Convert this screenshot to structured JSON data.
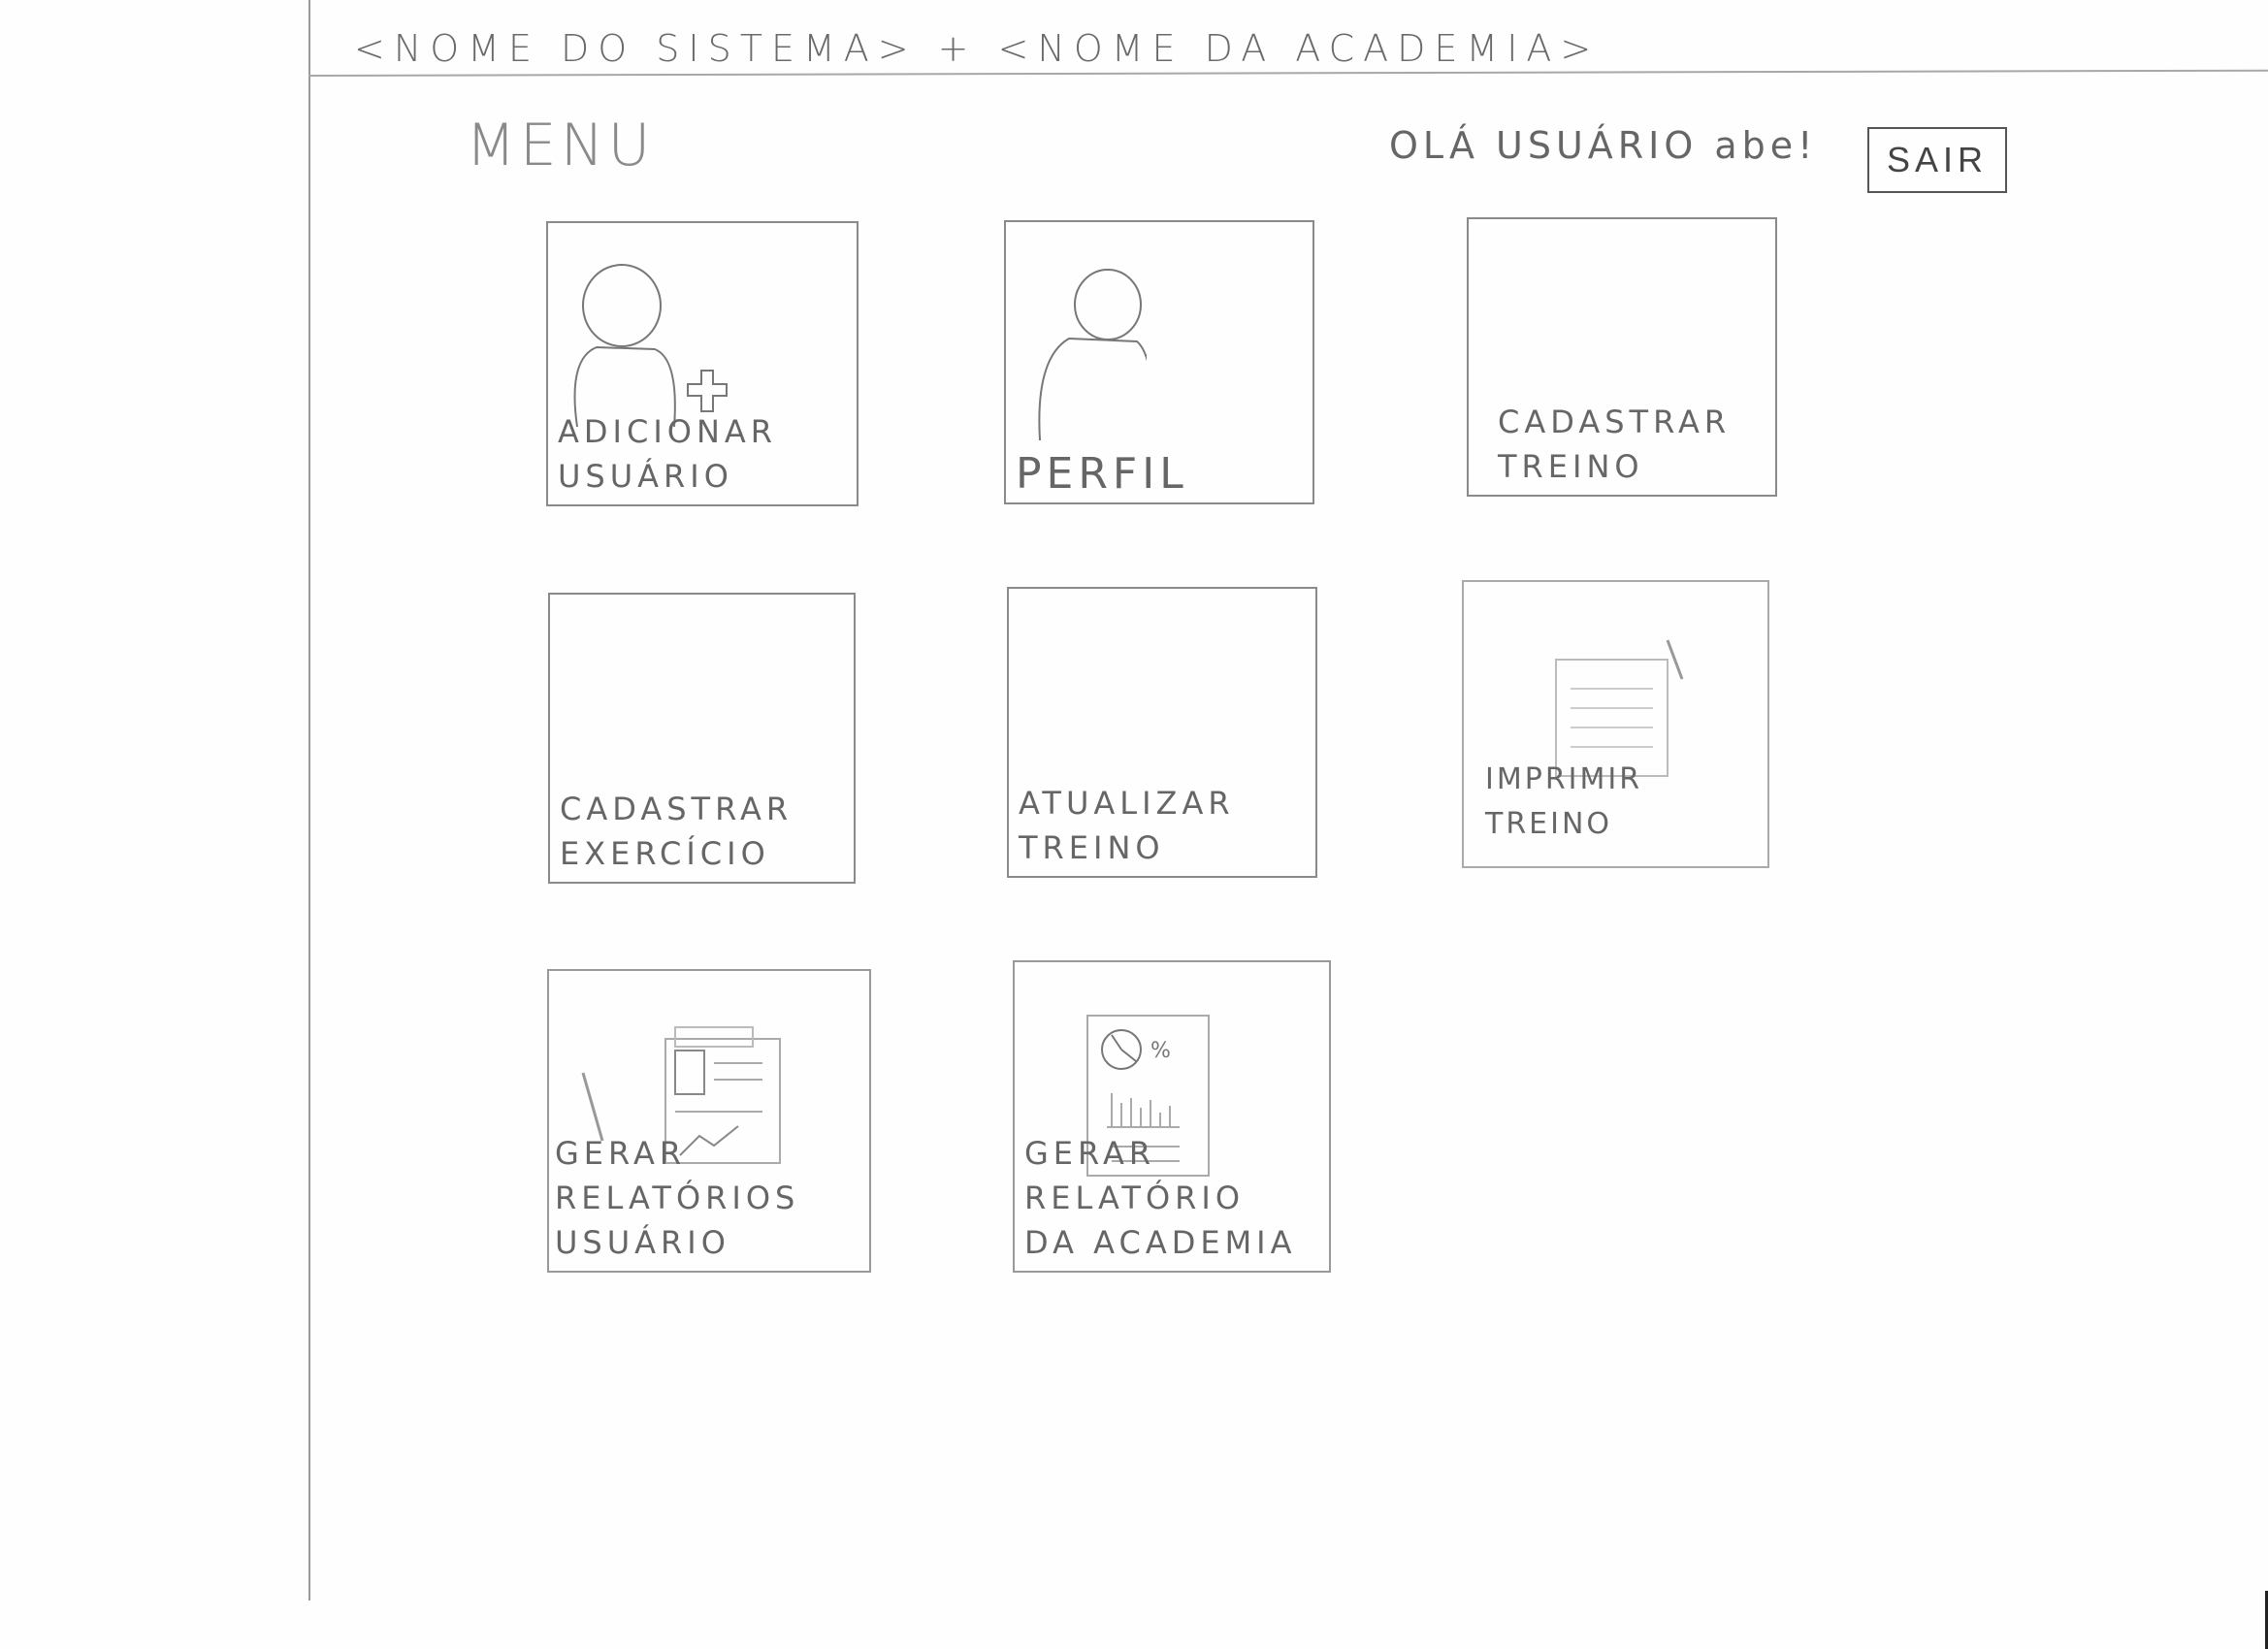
{
  "header": {
    "title": "<NOME DO SISTEMA> + <NOME DA ACADEMIA>"
  },
  "page": {
    "heading": "MENU",
    "greeting": "OLÁ USUÁRIO abe!",
    "logout_label": "SAIR"
  },
  "cards": [
    {
      "label": "ADICIONAR\nUSUÁRIO",
      "icon": "user-add-icon"
    },
    {
      "label": "PERFIL",
      "icon": "user-icon"
    },
    {
      "label": "CADASTRAR\nTREINO",
      "icon": ""
    },
    {
      "label": "CADASTRAR\nEXERCÍCIO",
      "icon": ""
    },
    {
      "label": "ATUALIZAR\nTREINO",
      "icon": ""
    },
    {
      "label": "IMPRIMIR TREINO",
      "icon": "document-print-icon"
    },
    {
      "label": "GERAR RELATÓRIOS\nUSUÁRIO",
      "icon": "user-report-icon"
    },
    {
      "label": "GERAR RELATÓRIO\nDA ACADEMIA",
      "icon": "chart-report-icon"
    }
  ]
}
